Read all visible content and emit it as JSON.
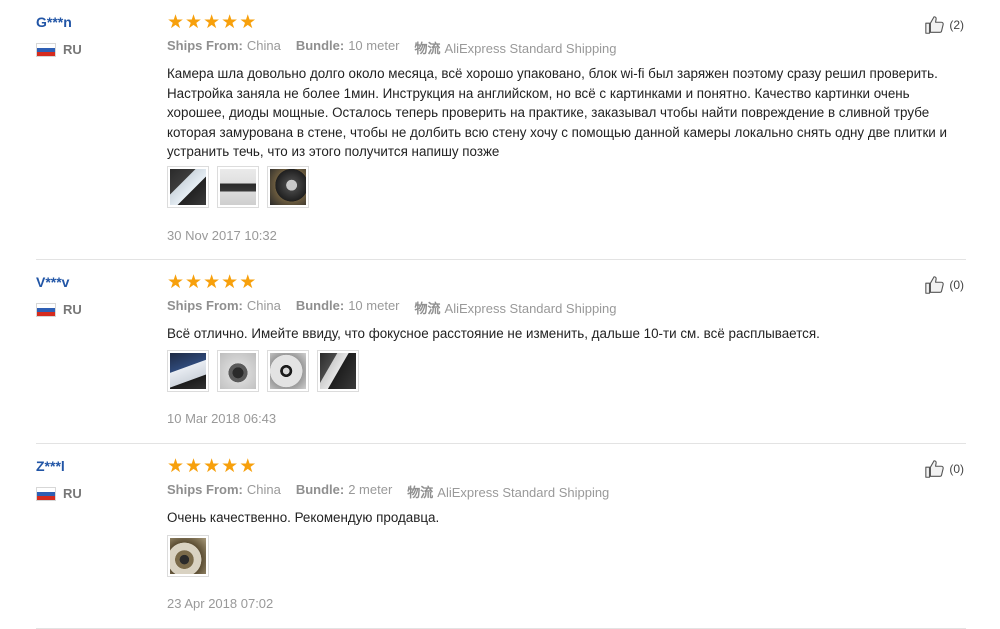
{
  "reviews": [
    {
      "user": "G***n",
      "country": "RU",
      "rating": 5,
      "ships_from_label": "Ships From:",
      "ships_from": "China",
      "bundle_label": "Bundle:",
      "bundle": "10 meter",
      "shipping_label": "物流",
      "shipping": "AliExpress Standard Shipping",
      "text": "Камера шла довольно долго около месяца, всё хорошо упаковано, блок wi-fi был заряжен поэтому сразу решил проверить. Настройка заняла не более 1мин. Инструкция на английском, но всё с картинками и понятно. Качество картинки очень хорошее, диоды мощные. Осталось теперь проверить на практике, заказывал чтобы найти повреждение в сливной трубе которая замурована в стене, чтобы не долбить всю стену хочу с помощью данной камеры локально снять одну две плитки и устранить течь, что из этого получится напишу позже",
      "photos": [
        "photo-1",
        "photo-2",
        "photo-3"
      ],
      "date": "30 Nov 2017 10:32",
      "helpful_count": "(2)"
    },
    {
      "user": "V***v",
      "country": "RU",
      "rating": 5,
      "ships_from_label": "Ships From:",
      "ships_from": "China",
      "bundle_label": "Bundle:",
      "bundle": "10 meter",
      "shipping_label": "物流",
      "shipping": "AliExpress Standard Shipping",
      "text": "Всё отлично. Имейте ввиду, что фокусное расстояние не изменить, дальше 10-ти см. всё расплывается.",
      "photos": [
        "photo-1",
        "photo-2",
        "photo-3",
        "photo-4"
      ],
      "date": "10 Mar 2018 06:43",
      "helpful_count": "(0)"
    },
    {
      "user": "Z***l",
      "country": "RU",
      "rating": 5,
      "ships_from_label": "Ships From:",
      "ships_from": "China",
      "bundle_label": "Bundle:",
      "bundle": "2 meter",
      "shipping_label": "物流",
      "shipping": "AliExpress Standard Shipping",
      "text": "Очень качественно. Рекомендую продавца.",
      "photos": [
        "photo-1"
      ],
      "date": "23 Apr 2018 07:02",
      "helpful_count": "(0)"
    }
  ],
  "star_glyph": "★",
  "colors": {
    "username": "#2155a6",
    "star": "#f7a00c",
    "meta_gray": "#999999"
  }
}
